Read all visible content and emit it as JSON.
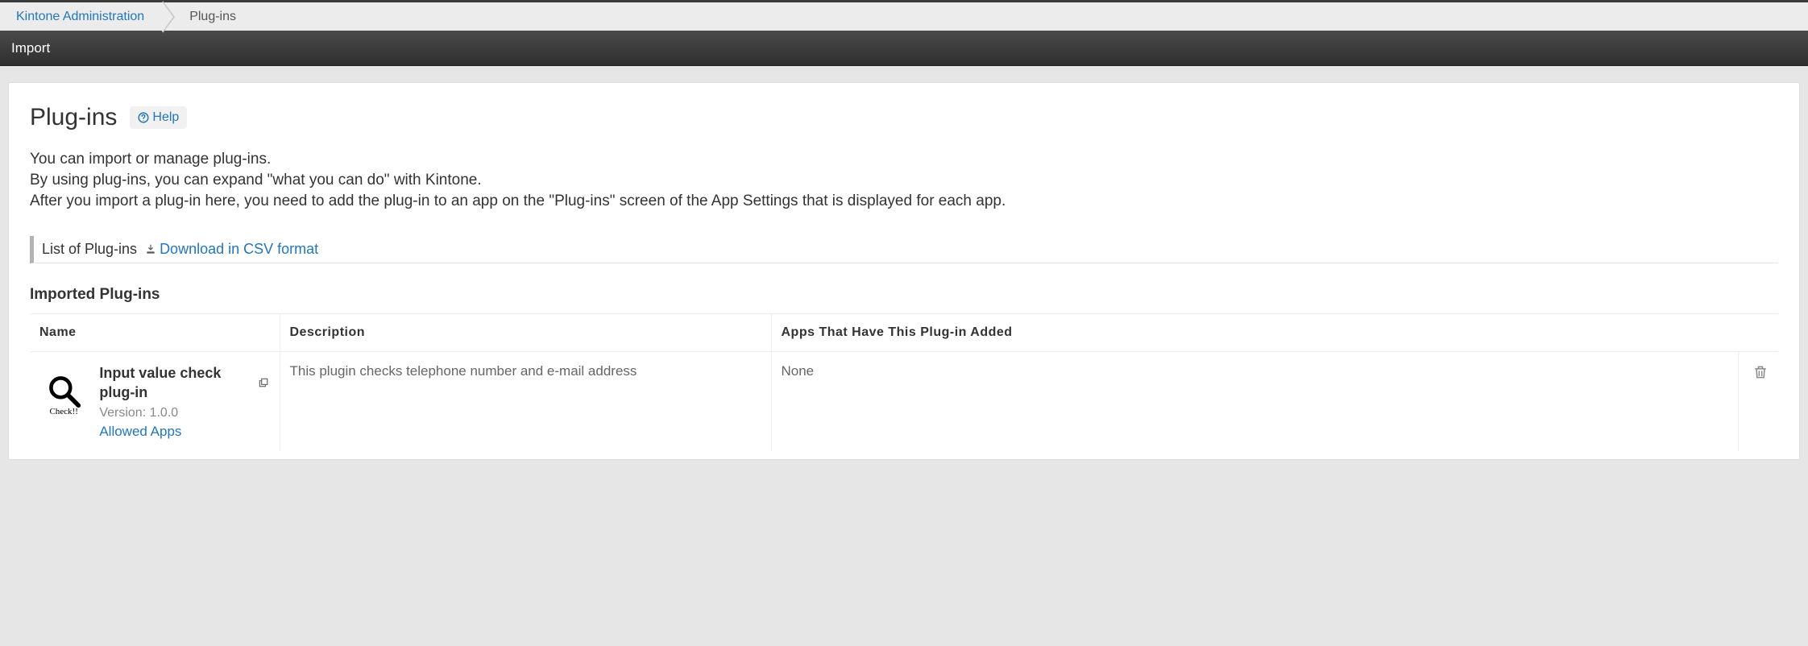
{
  "breadcrumb": {
    "root": "Kintone Administration",
    "current": "Plug-ins"
  },
  "toolbar": {
    "import_label": "Import"
  },
  "header": {
    "title": "Plug-ins",
    "help_label": "Help"
  },
  "intro": {
    "line1": "You can import or manage plug-ins.",
    "line2": "By using plug-ins, you can expand \"what you can do\" with Kintone.",
    "line3": "After you import a plug-in here, you need to add the plug-in to an app on the \"Plug-ins\" screen of the App Settings that is displayed for each app."
  },
  "list_section": {
    "label": "List of Plug-ins",
    "download_label": "Download in CSV format"
  },
  "imported_title": "Imported Plug-ins",
  "columns": {
    "name": "Name",
    "description": "Description",
    "apps": "Apps That Have This Plug-in Added"
  },
  "plugins": [
    {
      "name": "Input value check plug-in",
      "icon_caption": "Check!!",
      "version_label": "Version: 1.0.0",
      "allowed_label": "Allowed Apps",
      "description": "This plugin checks telephone number and e-mail address",
      "apps": "None"
    }
  ]
}
